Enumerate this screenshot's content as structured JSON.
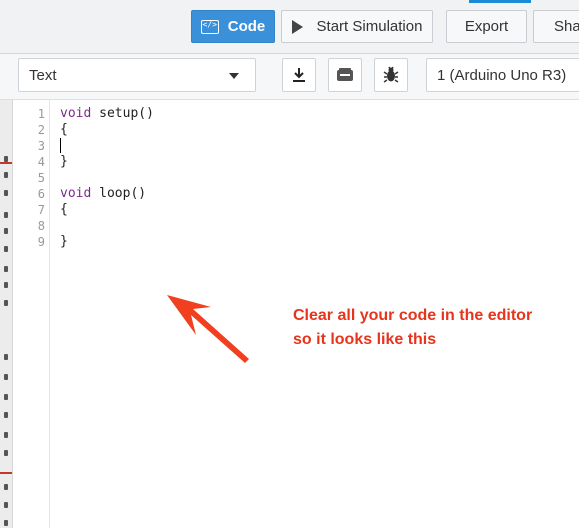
{
  "toolbar": {
    "code_label": "Code",
    "start_simulation_label": "Start Simulation",
    "export_label": "Export",
    "share_label": "Shar"
  },
  "editor_toolbar": {
    "mode_select_value": "Text",
    "download_icon": "download-icon",
    "library_icon": "library-icon",
    "debugger_icon": "bug-icon",
    "board_select_value": "1 (Arduino Uno R3)"
  },
  "editor": {
    "line_numbers": [
      "1",
      "2",
      "3",
      "4",
      "5",
      "6",
      "7",
      "8",
      "9"
    ],
    "lines": [
      {
        "kw": "void",
        "rest": " setup()"
      },
      {
        "kw": "",
        "rest": "{"
      },
      {
        "kw": "",
        "rest": ""
      },
      {
        "kw": "",
        "rest": "}"
      },
      {
        "kw": "",
        "rest": ""
      },
      {
        "kw": "void",
        "rest": " loop()"
      },
      {
        "kw": "",
        "rest": "{"
      },
      {
        "kw": "",
        "rest": ""
      },
      {
        "kw": "",
        "rest": "}"
      }
    ]
  },
  "annotation": {
    "line1": "Clear all your code in the editor",
    "line2": "so it looks like this"
  },
  "colors": {
    "accent": "#3a90d9",
    "keyword": "#7a2b8a",
    "annotation": "#e8341c"
  }
}
